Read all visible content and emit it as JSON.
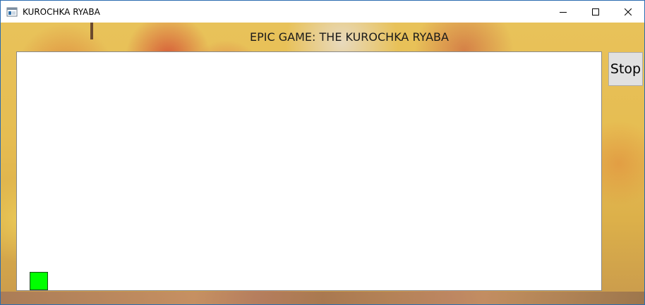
{
  "window": {
    "title": "KUROCHKA RYABA",
    "icon": "app-window-icon",
    "controls": [
      "minimize-icon",
      "maximize-icon",
      "close-icon"
    ]
  },
  "game": {
    "heading": "EPIC GAME: THE KUROCHKA RYABA",
    "stop_label": "Stop",
    "player_color": "#00ff00",
    "field_background": "#ffffff"
  }
}
